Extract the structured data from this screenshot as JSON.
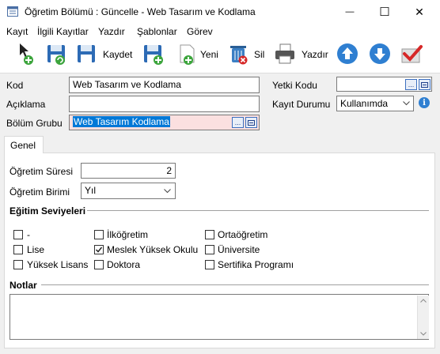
{
  "window": {
    "title": "Öğretim Bölümü : Güncelle - Web Tasarım ve Kodlama",
    "minimize_glyph": "—",
    "maximize_glyph": "☐",
    "close_glyph": "✕"
  },
  "menu": [
    "Kayıt",
    "İlgili Kayıtlar",
    "Yazdır",
    "Şablonlar",
    "Görev"
  ],
  "toolbar": {
    "save_label": "Kaydet",
    "new_label": "Yeni",
    "delete_label": "Sil",
    "print_label": "Yazdır"
  },
  "form": {
    "kod_label": "Kod",
    "kod_value": "Web Tasarım ve Kodlama",
    "aciklama_label": "Açıklama",
    "aciklama_value": "",
    "bolum_grubu_label": "Bölüm Grubu",
    "bolum_grubu_value": "Web Tasarım Kodlama",
    "yetki_kodu_label": "Yetki Kodu",
    "yetki_kodu_value": "",
    "kayit_durumu_label": "Kayıt Durumu",
    "kayit_durumu_value": "Kullanımda",
    "lookup_button": "...",
    "info_glyph": "i"
  },
  "tabs": [
    "Genel"
  ],
  "genel": {
    "ogretim_suresi_label": "Öğretim Süresi",
    "ogretim_suresi_value": "2",
    "ogretim_birimi_label": "Öğretim Birimi",
    "ogretim_birimi_value": "Yıl",
    "egitim_seviyeleri_label": "Eğitim Seviyeleri",
    "levels": [
      {
        "label": "-",
        "checked": false
      },
      {
        "label": "İlköğretim",
        "checked": false
      },
      {
        "label": "Ortaöğretim",
        "checked": false
      },
      {
        "label": "Lise",
        "checked": false
      },
      {
        "label": "Meslek Yüksek Okulu",
        "checked": true
      },
      {
        "label": "Üniversite",
        "checked": false
      },
      {
        "label": "Yüksek Lisans",
        "checked": false
      },
      {
        "label": "Doktora",
        "checked": false
      },
      {
        "label": "Sertifika Programı",
        "checked": false
      }
    ],
    "notlar_label": "Notlar",
    "notlar_value": ""
  },
  "colors": {
    "selection_bg": "#0078d7",
    "highlight_field": "#fbe0e0",
    "arrow_blue": "#2f7fd1",
    "green": "#3da53d"
  }
}
